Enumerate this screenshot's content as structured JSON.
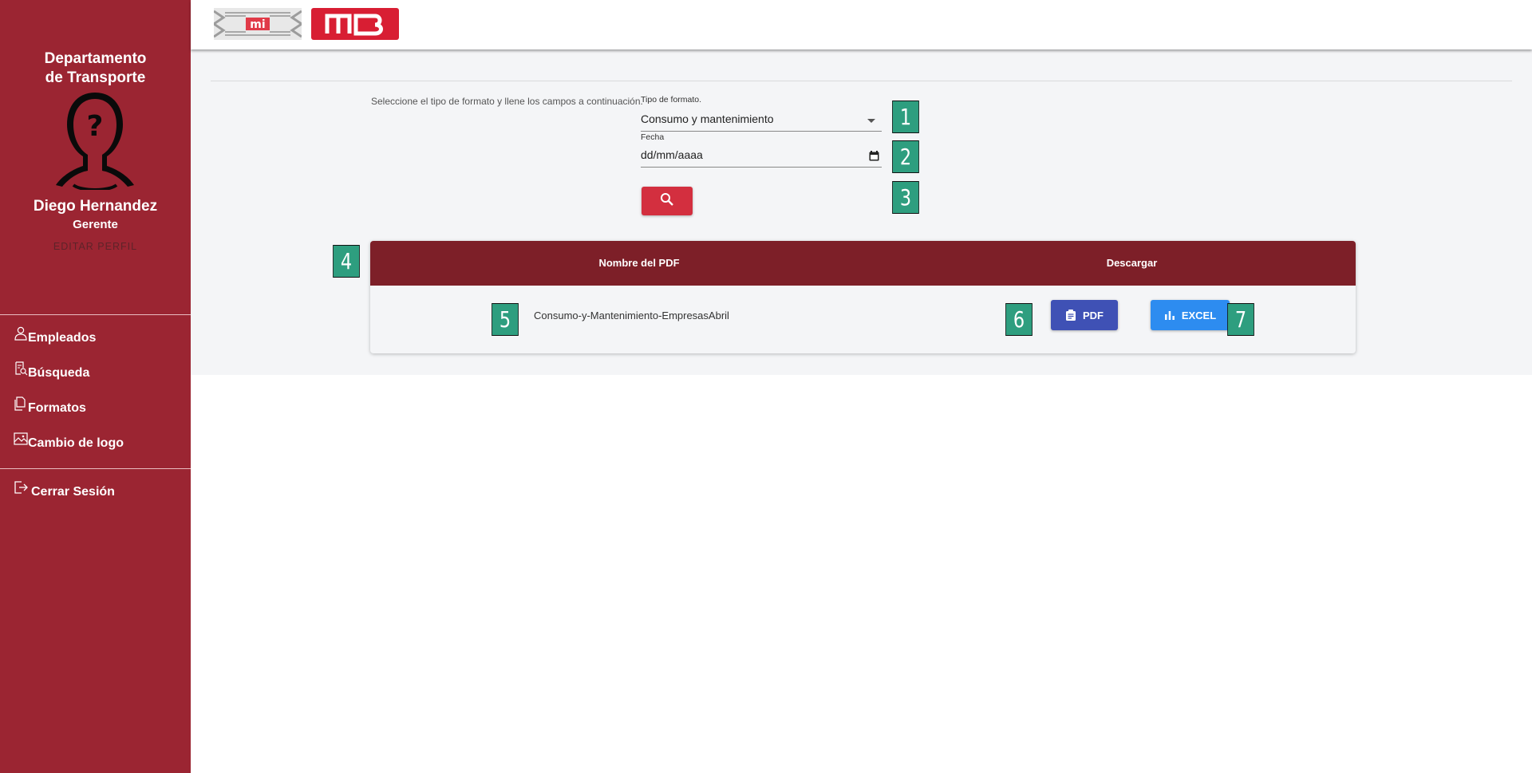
{
  "sidebar": {
    "department": "Departamento de Transporte",
    "user_name": "Diego Hernandez",
    "user_role": "Gerente",
    "edit_profile": "EDITAR PERFIL",
    "items": [
      {
        "label": "Empleados",
        "icon": "person-icon"
      },
      {
        "label": "Búsqueda",
        "icon": "document-search-icon"
      },
      {
        "label": "Formatos",
        "icon": "files-icon"
      },
      {
        "label": "Cambio de logo",
        "icon": "image-icon"
      }
    ],
    "logout": {
      "label": "Cerrar Sesión",
      "icon": "logout-icon"
    }
  },
  "form": {
    "instructions": "Seleccione el tipo de formato y llene los campos a continuación.",
    "type_label": "Tipo de formato.",
    "type_value": "Consumo y mantenimiento",
    "date_label": "Fecha",
    "date_value": "dd/mm/aaaa"
  },
  "table": {
    "headers": [
      "Nombre del PDF",
      "Descargar"
    ],
    "rows": [
      {
        "name": "Consumo-y-Mantenimiento-EmpresasAbril"
      }
    ],
    "pdf_button": "PDF",
    "excel_button": "EXCEL"
  },
  "markers": [
    "1",
    "2",
    "3",
    "4",
    "5",
    "6",
    "7"
  ],
  "colors": {
    "sidebar": "#9b2532",
    "table_header": "#7d1f28",
    "search_button": "#d32f3f",
    "pdf_button": "#3f51b5",
    "excel_button": "#2d8cf0",
    "marker": "#2e9e7f"
  }
}
